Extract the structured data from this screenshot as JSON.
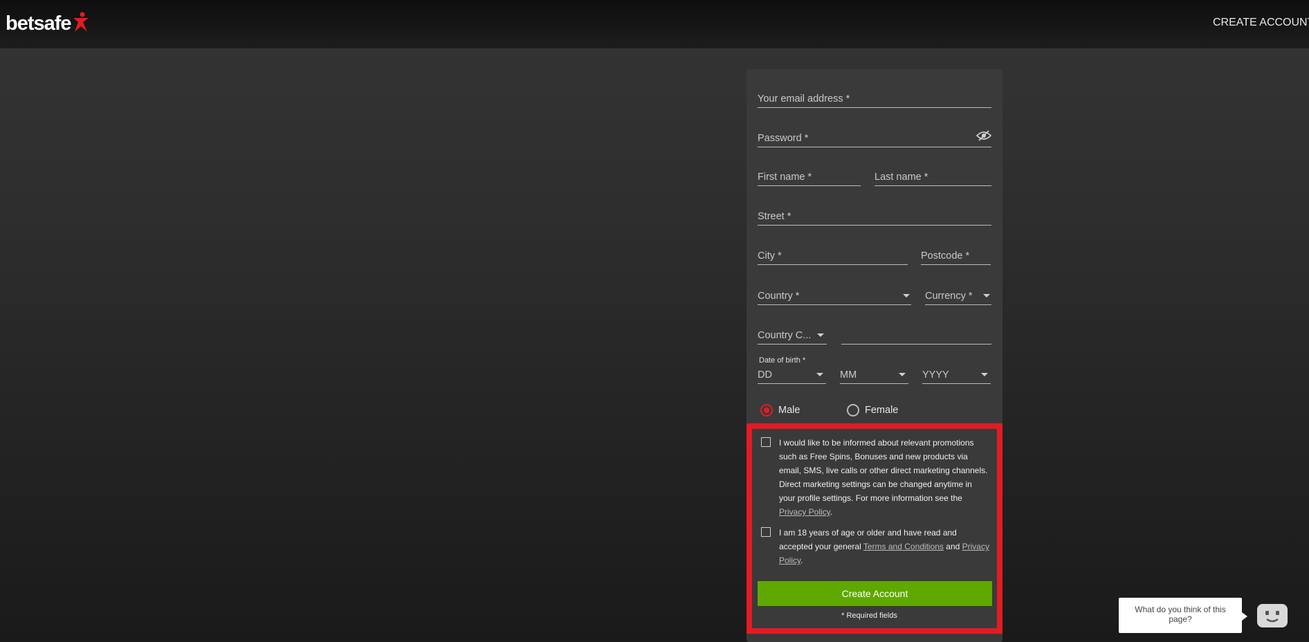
{
  "header": {
    "logo_text": "betsafe",
    "create_account_link": "CREATE ACCOUNT"
  },
  "form": {
    "email_placeholder": "Your email address *",
    "password_placeholder": "Password *",
    "first_name_placeholder": "First name *",
    "last_name_placeholder": "Last name *",
    "street_placeholder": "Street *",
    "city_placeholder": "City *",
    "postcode_placeholder": "Postcode *",
    "country_placeholder": "Country *",
    "currency_placeholder": "Currency *",
    "country_code_placeholder": "Country C...",
    "phone_value": "",
    "dob_label": "Date of birth *",
    "dob_day": "DD",
    "dob_month": "MM",
    "dob_year": "YYYY",
    "gender": {
      "male_label": "Male",
      "female_label": "Female",
      "selected": "Male"
    },
    "marketing_consent": {
      "text_before_link": "I would like to be informed about relevant promotions such as Free Spins, Bonuses and new products via email, SMS, live calls or other direct marketing channels. Direct marketing settings can be changed anytime in your profile settings. For more information see the ",
      "privacy_link": "Privacy Policy",
      "text_after_link": ".",
      "checked": false
    },
    "age_consent": {
      "text_before_terms": "I am 18 years of age or older and have read and accepted your general ",
      "terms_link": "Terms and Conditions",
      "text_between": " and ",
      "privacy_link": "Privacy Policy",
      "text_after": ".",
      "checked": false
    },
    "submit_label": "Create Account",
    "required_note": "* Required fields"
  },
  "feedback_widget": {
    "text": "What do you think of this page?"
  },
  "colors": {
    "accent_red": "#e31b23",
    "cta_green": "#5fa800",
    "panel_bg": "#3a3a3a"
  }
}
